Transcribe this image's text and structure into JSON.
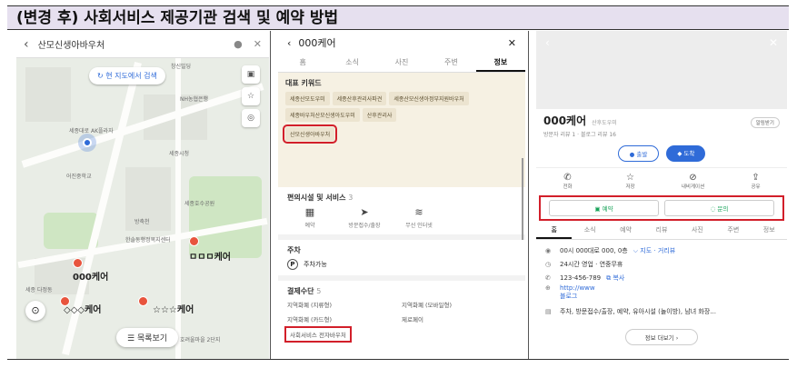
{
  "title": "(변경 후) 사회서비스 제공기관 검색 및 예약 방법",
  "map": {
    "search_query": "산모신생아바우처",
    "research_button": "현 지도에서 검색",
    "list_button": "목록보기",
    "place_labels": [
      "ㅁㅁㅁ케어",
      "000케어",
      "◇◇◇케어",
      "☆☆☆케어"
    ],
    "street_labels": [
      "창신빌딩",
      "세종대로 AK플라자",
      "NH농협은행",
      "세종시청",
      "어진중학교",
      "세종호수공원",
      "방축천",
      "한솔동행정복지센터",
      "세종 다정동",
      "호려울마을 2단지"
    ]
  },
  "info": {
    "name": "000케어",
    "tabs": [
      "홈",
      "소식",
      "사진",
      "주변",
      "정보"
    ],
    "active_tab": "정보",
    "keywords_title": "대표 키워드",
    "keywords": [
      "세종산모도우미",
      "세종산후관리사파견",
      "세종산모신생아정부지원바우처",
      "세종바우처산모신생아도우미",
      "산후관리사",
      "산모신생아바우처"
    ],
    "facilities_title": "편의시설 및 서비스",
    "facilities_count": "3",
    "facilities": [
      "예약",
      "방문접수/출장",
      "무선 인터넷"
    ],
    "parking_title": "주차",
    "parking_text": "주차가능",
    "payment_title": "결제수단",
    "payment_count": "5",
    "payments": [
      "지역화폐 (지류형)",
      "지역화폐 (모바일형)",
      "지역화폐 (카드형)",
      "제로페이",
      "사회서비스 전자바우처"
    ]
  },
  "detail": {
    "name": "000케어",
    "category": "산후도우미",
    "reviews": "방문자 리뷰 1 · 블로그 리뷰 16",
    "save_label": "알림받기",
    "depart": "출발",
    "arrive": "도착",
    "actions": [
      "전화",
      "저장",
      "내비게이션",
      "공유"
    ],
    "book": "예약",
    "inquiry": "문의",
    "tabs": [
      "홈",
      "소식",
      "예약",
      "리뷰",
      "사진",
      "주변",
      "정보"
    ],
    "address": "00시 000대로 000, 0층",
    "address_sub": "지도 · 거리뷰",
    "hours": "24시간 영업 · 연중무휴",
    "phone": "123-456-789",
    "copy": "복사",
    "website": "http://www",
    "blog": "블로그",
    "amenities": "주차, 방문접수/출장, 예약, 유아시설 (놀이방), 남녀 화장...",
    "more": "정보 더보기"
  }
}
